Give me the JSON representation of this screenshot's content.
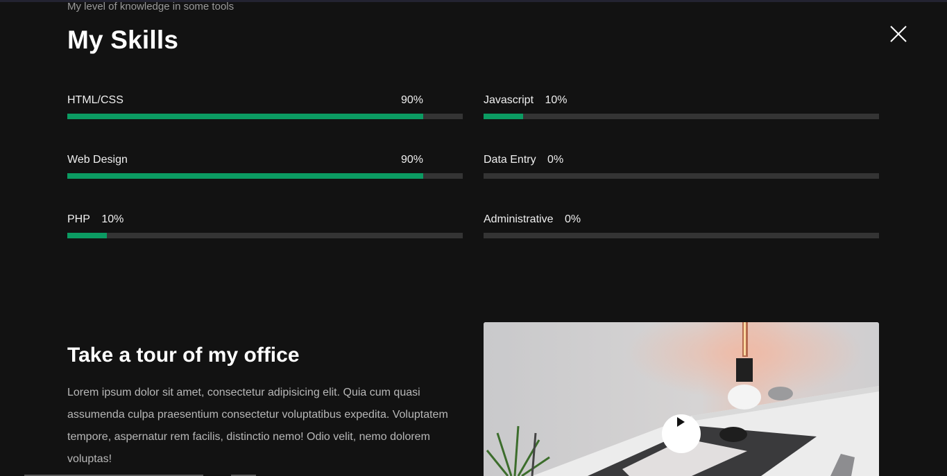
{
  "skills_section": {
    "subtitle": "My level of knowledge in some tools",
    "title": "My Skills",
    "left": [
      {
        "name": "HTML/CSS",
        "percent_label": "90%",
        "level": 0.9
      },
      {
        "name": "Web Design",
        "percent_label": "90%",
        "level": 0.9
      },
      {
        "name": "PHP",
        "percent_label": "10%",
        "level": 0.1
      }
    ],
    "right": [
      {
        "name": "Javascript",
        "percent_label": "10%",
        "level": 0.1
      },
      {
        "name": "Data Entry",
        "percent_label": "0%",
        "level": 0
      },
      {
        "name": "Administrative",
        "percent_label": "0%",
        "level": 0
      }
    ]
  },
  "tour_section": {
    "title": "Take a tour of my office",
    "text": "Lorem ipsum dolor sit amet, consectetur adipisicing elit. Quia cum quasi assumenda culpa praesentium consectetur voluptatibus expedita. Voluptatem tempore, aspernatur rem facilis, distinctio nemo! Odio velit, nemo dolorem voluptas!"
  },
  "icons": {
    "close": "close-icon",
    "play": "play-icon"
  },
  "colors": {
    "background": "#121212",
    "accent": "#0b9b62",
    "track": "#343434"
  }
}
